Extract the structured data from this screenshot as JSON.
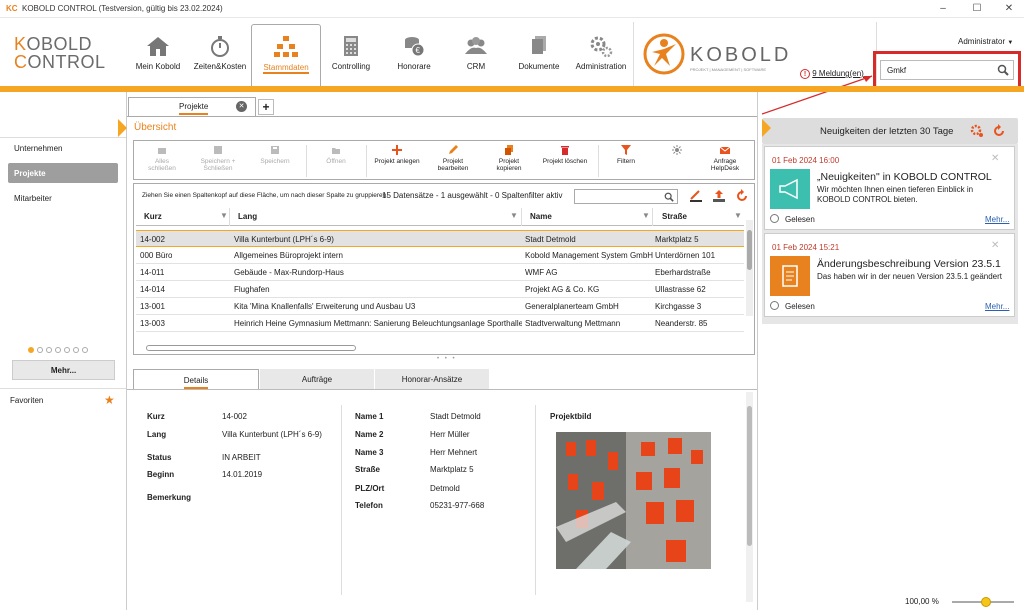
{
  "window": {
    "logo": "KC",
    "title": "KOBOLD CONTROL (Testversion, gültig bis 23.02.2024)",
    "min": "–",
    "max": "☐",
    "close": "✕"
  },
  "brand": {
    "k": "K",
    "line1_rest": "OBOLD",
    "c": "C",
    "line2_rest": "ONTROL"
  },
  "nav": [
    {
      "label": "Mein Kobold",
      "icon": "house-icon"
    },
    {
      "label": "Zeiten&Kosten",
      "icon": "stopwatch-icon"
    },
    {
      "label": "Stammdaten",
      "icon": "org-chart-icon"
    },
    {
      "label": "Controlling",
      "icon": "calculator-icon"
    },
    {
      "label": "Honorare",
      "icon": "coins-icon"
    },
    {
      "label": "CRM",
      "icon": "people-icon"
    },
    {
      "label": "Dokumente",
      "icon": "documents-icon"
    },
    {
      "label": "Administration",
      "icon": "gears-icon"
    }
  ],
  "kobold_logo": {
    "name": "KOBOLD",
    "sub": "PROJEKT | MANAGEMENT | SOFTWARE"
  },
  "user": {
    "name": "Administrator"
  },
  "messages": {
    "text": "9 Meldung(en)",
    "alert": "!"
  },
  "search": {
    "value": "Gmkf"
  },
  "leftnav": {
    "items": [
      "Unternehmen",
      "Projekte",
      "Mitarbeiter"
    ],
    "more": "Mehr...",
    "favorites": "Favoriten"
  },
  "tab": {
    "label": "Projekte",
    "add": "+",
    "close": "✕"
  },
  "overview": {
    "title": "Übersicht"
  },
  "toolbar": [
    {
      "label": "Alles schließen",
      "enabled": false
    },
    {
      "label": "Speichern + Schließen",
      "enabled": false
    },
    {
      "label": "Speichern",
      "enabled": false
    },
    {
      "label": "Öffnen",
      "enabled": false
    },
    {
      "label": "Projekt anlegen",
      "enabled": true
    },
    {
      "label": "Projekt bearbeiten",
      "enabled": true
    },
    {
      "label": "Projekt kopieren",
      "enabled": true
    },
    {
      "label": "Projekt löschen",
      "enabled": true
    },
    {
      "label": "Filtern",
      "enabled": true
    },
    {
      "label": "",
      "enabled": true
    },
    {
      "label": "Anfrage HelpDesk",
      "enabled": true
    }
  ],
  "grid": {
    "hint": "Ziehen Sie einen Spaltenkopf auf diese Fläche, um nach dieser Spalte zu gruppieren.",
    "count": "15 Datensätze - 1 ausgewählt - 0 Spaltenfilter aktiv",
    "columns": [
      "Kurz",
      "Lang",
      "Name",
      "Straße"
    ],
    "rows": [
      [
        "14-002",
        "Villa Kunterbunt (LPH´s 6-9)",
        "Stadt Detmold",
        "Marktplatz 5"
      ],
      [
        "000 Büro",
        "Allgemeines Büroprojekt intern",
        "Kobold Management System GmbH",
        "Unterdörnen 101"
      ],
      [
        "14-011",
        "Gebäude - Max-Rundorp-Haus",
        "WMF AG",
        "Eberhardstraße"
      ],
      [
        "14-014",
        "Flughafen",
        "Projekt AG & Co. KG",
        "Ullastrasse 62"
      ],
      [
        "13-001",
        "Kita 'Mina Knallenfalls' Erweiterung und Ausbau U3",
        "Generalplanerteam GmbH",
        "Kirchgasse 3"
      ],
      [
        "13-003",
        "Heinrich Heine Gymnasium Mettmann: Sanierung Beleuchtungsanlage Sporthalle",
        "Stadtverwaltung Mettmann",
        "Neanderstr. 85"
      ]
    ]
  },
  "detail_tabs": [
    "Details",
    "Aufträge",
    "Honorar-Ansätze"
  ],
  "details": {
    "kurz_l": "Kurz",
    "kurz": "14-002",
    "lang_l": "Lang",
    "lang": "Villa Kunterbunt (LPH´s 6-9)",
    "status_l": "Status",
    "status": "IN ARBEIT",
    "beginn_l": "Beginn",
    "beginn": "14.01.2019",
    "bem_l": "Bemerkung",
    "n1_l": "Name 1",
    "n1": "Stadt Detmold",
    "n2_l": "Name 2",
    "n2": "Herr Müller",
    "n3_l": "Name 3",
    "n3": "Herr Mehnert",
    "str_l": "Straße",
    "str": "Marktplatz 5",
    "plz_l": "PLZ/Ort",
    "plz": "Detmold",
    "tel_l": "Telefon",
    "tel": "05231-977-668",
    "bild_l": "Projektbild"
  },
  "news": {
    "title": "Neuigkeiten der letzten 30 Tage",
    "items": [
      {
        "date": "01 Feb 2024 16:00",
        "title": "„Neuigkeiten\" in KOBOLD CONTROL",
        "text": "Wir möchten Ihnen einen tieferen Einblick in KOBOLD CONTROL bieten.",
        "read": "Gelesen",
        "more": "Mehr..."
      },
      {
        "date": "01 Feb 2024 15:21",
        "title": "Änderungsbeschreibung Version 23.5.1",
        "text": "Das haben wir in der neuen Version 23.5.1 geändert",
        "read": "Gelesen",
        "more": "Mehr..."
      }
    ]
  },
  "zoom": "100,00 %",
  "zoom_level": 0.55,
  "colors": {
    "accent": "#e8821e",
    "accent2": "#f5a623",
    "alert": "#d62b2b",
    "teal": "#3dbfb0"
  }
}
